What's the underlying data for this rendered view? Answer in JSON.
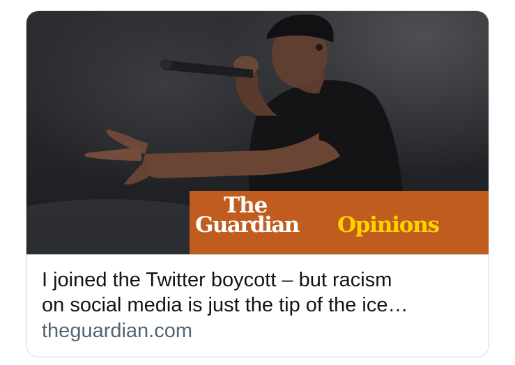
{
  "link_card": {
    "image": {
      "description": "photo",
      "banner": {
        "the": "The",
        "guardian": "Guardian",
        "opinions": "Opinions",
        "background_color": "#c05d1e",
        "opinions_color": "#ffd300"
      }
    },
    "title_line_1": "I joined the Twitter boycott – but racism",
    "title_line_2": "on social media is just the tip of the ice…",
    "domain": "theguardian.com"
  }
}
